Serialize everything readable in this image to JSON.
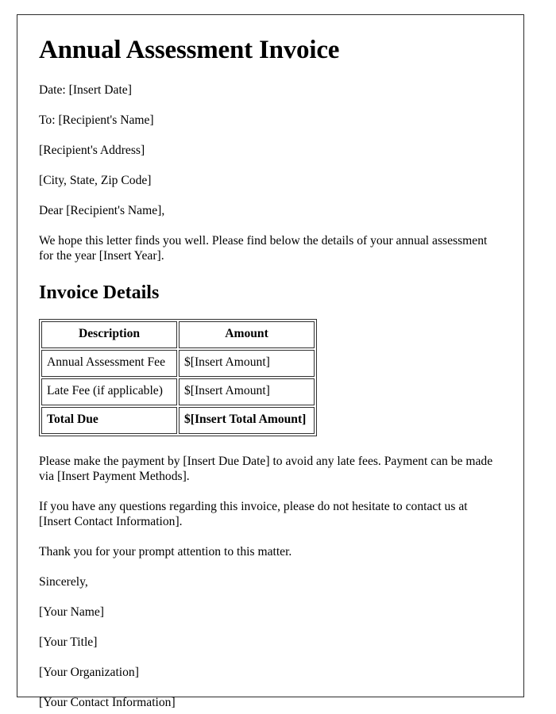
{
  "document": {
    "title": "Annual Assessment Invoice",
    "header_lines": [
      "Date: [Insert Date]",
      "To: [Recipient's Name]",
      "[Recipient's Address]",
      "[City, State, Zip Code]",
      "Dear [Recipient's Name],"
    ],
    "intro_paragraph": "We hope this letter finds you well. Please find below the details of your annual assessment for the year [Insert Year].",
    "section_heading": "Invoice Details",
    "table": {
      "columns": [
        "Description",
        "Amount"
      ],
      "rows": [
        {
          "description": "Annual Assessment Fee",
          "amount": "$[Insert Amount]",
          "emphasis": false
        },
        {
          "description": "Late Fee (if applicable)",
          "amount": "$[Insert Amount]",
          "emphasis": false
        },
        {
          "description": "Total Due",
          "amount": "$[Insert Total Amount]",
          "emphasis": true
        }
      ]
    },
    "payment_paragraph": "Please make the payment by [Insert Due Date] to avoid any late fees. Payment can be made via [Insert Payment Methods].",
    "questions_paragraph": "If you have any questions regarding this invoice, please do not hesitate to contact us at [Insert Contact Information].",
    "thanks_paragraph": "Thank you for your prompt attention to this matter.",
    "closing": "Sincerely,",
    "signature_lines": [
      "[Your Name]",
      "[Your Title]",
      "[Your Organization]",
      "[Your Contact Information]"
    ]
  },
  "style": {
    "text_color": "#000000",
    "page_background": "#ffffff",
    "border_color": "#2b2b2b",
    "table_border_color": "#303030"
  }
}
